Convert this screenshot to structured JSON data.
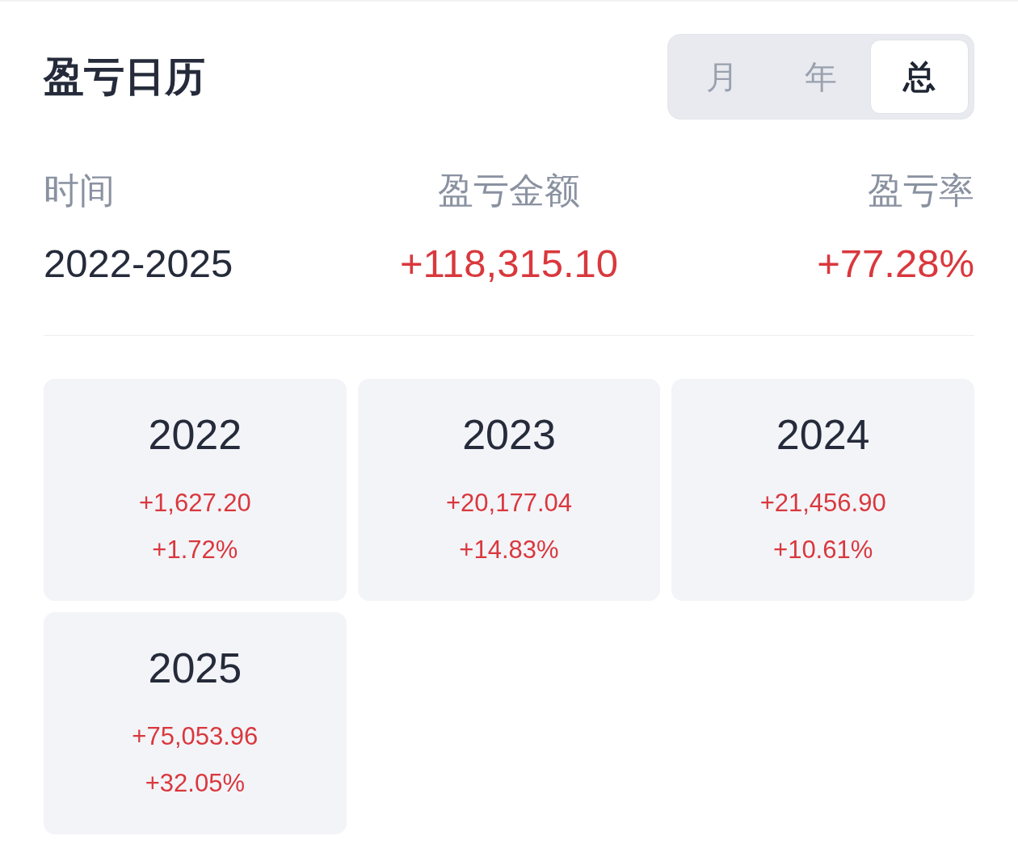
{
  "header": {
    "title": "盈亏日历",
    "tabs": [
      {
        "label": "月",
        "selected": false
      },
      {
        "label": "年",
        "selected": false
      },
      {
        "label": "总",
        "selected": true
      }
    ]
  },
  "summary": [
    {
      "label": "时间",
      "value": "2022-2025",
      "kind": "period"
    },
    {
      "label": "盈亏金额",
      "value": "+118,315.10",
      "kind": "amount"
    },
    {
      "label": "盈亏率",
      "value": "+77.28%",
      "kind": "rate"
    }
  ],
  "years": [
    {
      "year": "2022",
      "amount": "+1,627.20",
      "rate": "+1.72%"
    },
    {
      "year": "2023",
      "amount": "+20,177.04",
      "rate": "+14.83%"
    },
    {
      "year": "2024",
      "amount": "+21,456.90",
      "rate": "+10.61%"
    },
    {
      "year": "2025",
      "amount": "+75,053.96",
      "rate": "+32.05%"
    }
  ]
}
